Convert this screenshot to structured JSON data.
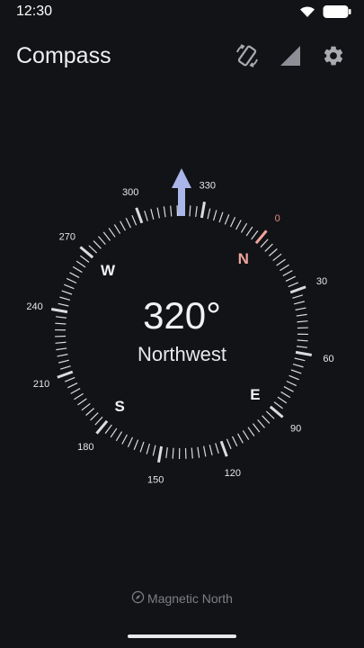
{
  "status_bar": {
    "time": "12:30",
    "icons": [
      "wifi-icon",
      "battery-icon"
    ]
  },
  "app_bar": {
    "title": "Compass",
    "actions": [
      "rotate-calibrate-icon",
      "signal-strength-icon",
      "settings-icon"
    ]
  },
  "compass": {
    "heading_degrees": 320,
    "heading_text": "320°",
    "direction_text": "Northwest",
    "cardinals": [
      {
        "label": "N",
        "angle": 0,
        "color": "#f0a59b"
      },
      {
        "label": "E",
        "angle": 90,
        "color": "#f2f2f5"
      },
      {
        "label": "S",
        "angle": 180,
        "color": "#f2f2f5"
      },
      {
        "label": "W",
        "angle": 270,
        "color": "#f2f2f5"
      }
    ],
    "degree_labels": [
      {
        "text": "0",
        "angle": 0,
        "color": "#e08d82"
      },
      {
        "text": "30",
        "angle": 30
      },
      {
        "text": "60",
        "angle": 60
      },
      {
        "text": "90",
        "angle": 90
      },
      {
        "text": "120",
        "angle": 120
      },
      {
        "text": "150",
        "angle": 150
      },
      {
        "text": "180",
        "angle": 180
      },
      {
        "text": "210",
        "angle": 210
      },
      {
        "text": "240",
        "angle": 240
      },
      {
        "text": "270",
        "angle": 270
      },
      {
        "text": "300",
        "angle": 300
      },
      {
        "text": "330",
        "angle": 330
      }
    ],
    "colors": {
      "pointer": "#aab6ea",
      "north_tick": "#f0a59b",
      "ticks": "#dcdce0"
    }
  },
  "footer": {
    "mode_label": "Magnetic North",
    "icon": "compass-icon"
  }
}
